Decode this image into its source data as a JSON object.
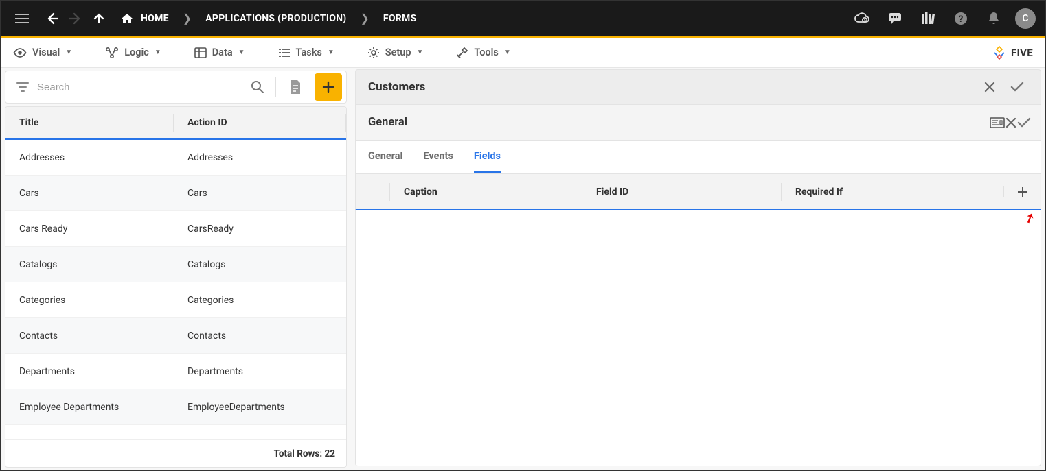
{
  "topbar": {
    "breadcrumbs": [
      "HOME",
      "APPLICATIONS (PRODUCTION)",
      "FORMS"
    ],
    "avatar_initial": "C"
  },
  "toolbar": {
    "visual": "Visual",
    "logic": "Logic",
    "data": "Data",
    "tasks": "Tasks",
    "setup": "Setup",
    "tools": "Tools",
    "brand": "FIVE"
  },
  "left": {
    "search_placeholder": "Search",
    "columns": {
      "title": "Title",
      "action_id": "Action ID"
    },
    "rows": [
      {
        "title": "Addresses",
        "action_id": "Addresses"
      },
      {
        "title": "Cars",
        "action_id": "Cars"
      },
      {
        "title": "Cars Ready",
        "action_id": "CarsReady"
      },
      {
        "title": "Catalogs",
        "action_id": "Catalogs"
      },
      {
        "title": "Categories",
        "action_id": "Categories"
      },
      {
        "title": "Contacts",
        "action_id": "Contacts"
      },
      {
        "title": "Departments",
        "action_id": "Departments"
      },
      {
        "title": "Employee Departments",
        "action_id": "EmployeeDepartments"
      }
    ],
    "footer_label": "Total Rows:",
    "footer_count": "22"
  },
  "right": {
    "header_title": "Customers",
    "sub_title": "General",
    "tabs": {
      "general": "General",
      "events": "Events",
      "fields": "Fields"
    },
    "fields_columns": {
      "caption": "Caption",
      "field_id": "Field ID",
      "required_if": "Required If"
    }
  }
}
